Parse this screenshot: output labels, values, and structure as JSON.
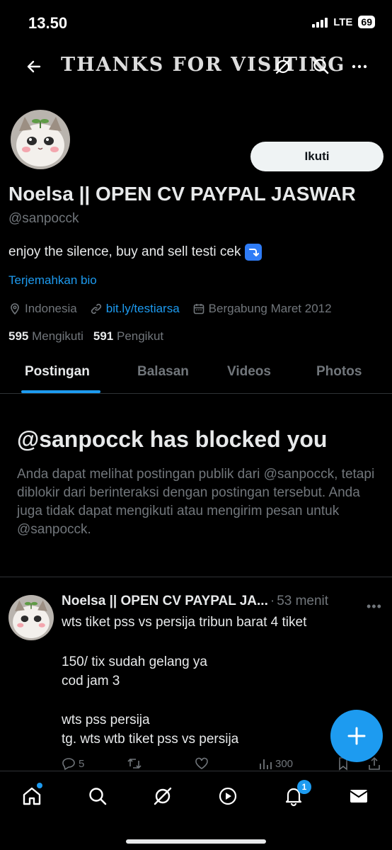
{
  "status_bar": {
    "time": "13.50",
    "network": "LTE",
    "battery": "69"
  },
  "header": {
    "title": "THANKS FOR VISITING",
    "icons": [
      "back-arrow-icon",
      "grok-icon",
      "search-icon",
      "more-icon"
    ]
  },
  "profile": {
    "display_name": "Noelsa || OPEN CV PAYPAL JASWAR",
    "handle": "@sanpocck",
    "follow_label": "Ikuti",
    "bio": "enjoy the silence, buy and sell testi cek",
    "bio_emoji": "right-arrow-curving-down-emoji",
    "translate_label": "Terjemahkan bio",
    "location": "Indonesia",
    "link": "bit.ly/testiarsa",
    "joined": "Bergabung Maret 2012",
    "following_count": "595",
    "following_label": "Mengikuti",
    "followers_count": "591",
    "followers_label": "Pengikut"
  },
  "tabs": [
    {
      "label": "Postingan",
      "active": true
    },
    {
      "label": "Balasan",
      "active": false
    },
    {
      "label": "Videos",
      "active": false
    },
    {
      "label": "Photos",
      "active": false
    }
  ],
  "blocked": {
    "title": "@sanpocck has blocked you",
    "description": "Anda dapat melihat postingan publik dari @sanpocck, tetapi diblokir dari berinteraksi dengan postingan tersebut. Anda juga tidak dapat mengikuti atau mengirim pesan untuk @sanpocck."
  },
  "post": {
    "author": "Noelsa || OPEN CV PAYPAL JA...",
    "separator": "·",
    "time": "53 menit",
    "lines": [
      "wts tiket pss vs persija tribun barat 4 tiket",
      "",
      "150/ tix sudah gelang ya",
      "cod jam 3",
      "",
      "wts pss persija",
      "tg. wts wtb tiket pss vs persija"
    ],
    "replies": "5",
    "views": "300"
  },
  "bottom_nav": {
    "items": [
      "home-icon",
      "search-icon",
      "grok-icon",
      "video-icon",
      "notifications-icon",
      "messages-icon"
    ],
    "notification_badge": "1"
  },
  "colors": {
    "background": "#000000",
    "accent": "#1d9bf0",
    "text_primary": "#e7e9ea",
    "text_secondary": "#71767b",
    "border": "#2f3336"
  }
}
